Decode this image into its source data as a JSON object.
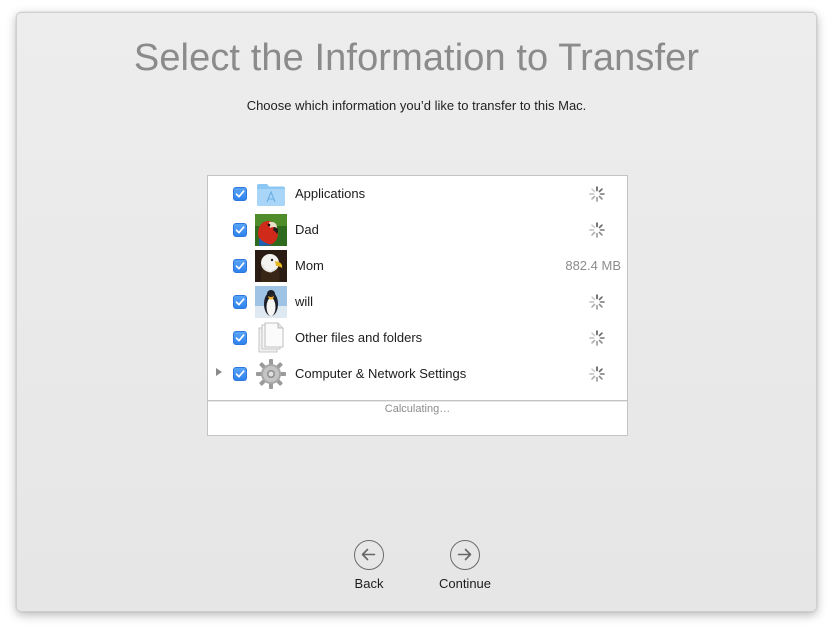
{
  "window": {
    "title": "Select the Information to Transfer",
    "subtitle": "Choose which information you’d like to transfer to this Mac."
  },
  "items": [
    {
      "label": "Applications",
      "checked": true,
      "icon": "applications-folder-icon",
      "size": "",
      "status": "calculating"
    },
    {
      "label": "Dad",
      "checked": true,
      "icon": "parrot-avatar-icon",
      "size": "",
      "status": "calculating"
    },
    {
      "label": "Mom",
      "checked": true,
      "icon": "eagle-avatar-icon",
      "size": "882.4 MB",
      "status": "done"
    },
    {
      "label": "will",
      "checked": true,
      "icon": "penguin-avatar-icon",
      "size": "",
      "status": "calculating"
    },
    {
      "label": "Other files and folders",
      "checked": true,
      "icon": "documents-icon",
      "size": "",
      "status": "calculating"
    },
    {
      "label": "Computer & Network Settings",
      "checked": true,
      "icon": "gear-icon",
      "size": "",
      "status": "calculating",
      "expandable": true
    }
  ],
  "footer": {
    "status": "Calculating…"
  },
  "nav": {
    "back_label": "Back",
    "continue_label": "Continue"
  },
  "colors": {
    "accent": "#3a8cf0",
    "title_gray": "#8b8b8b"
  }
}
